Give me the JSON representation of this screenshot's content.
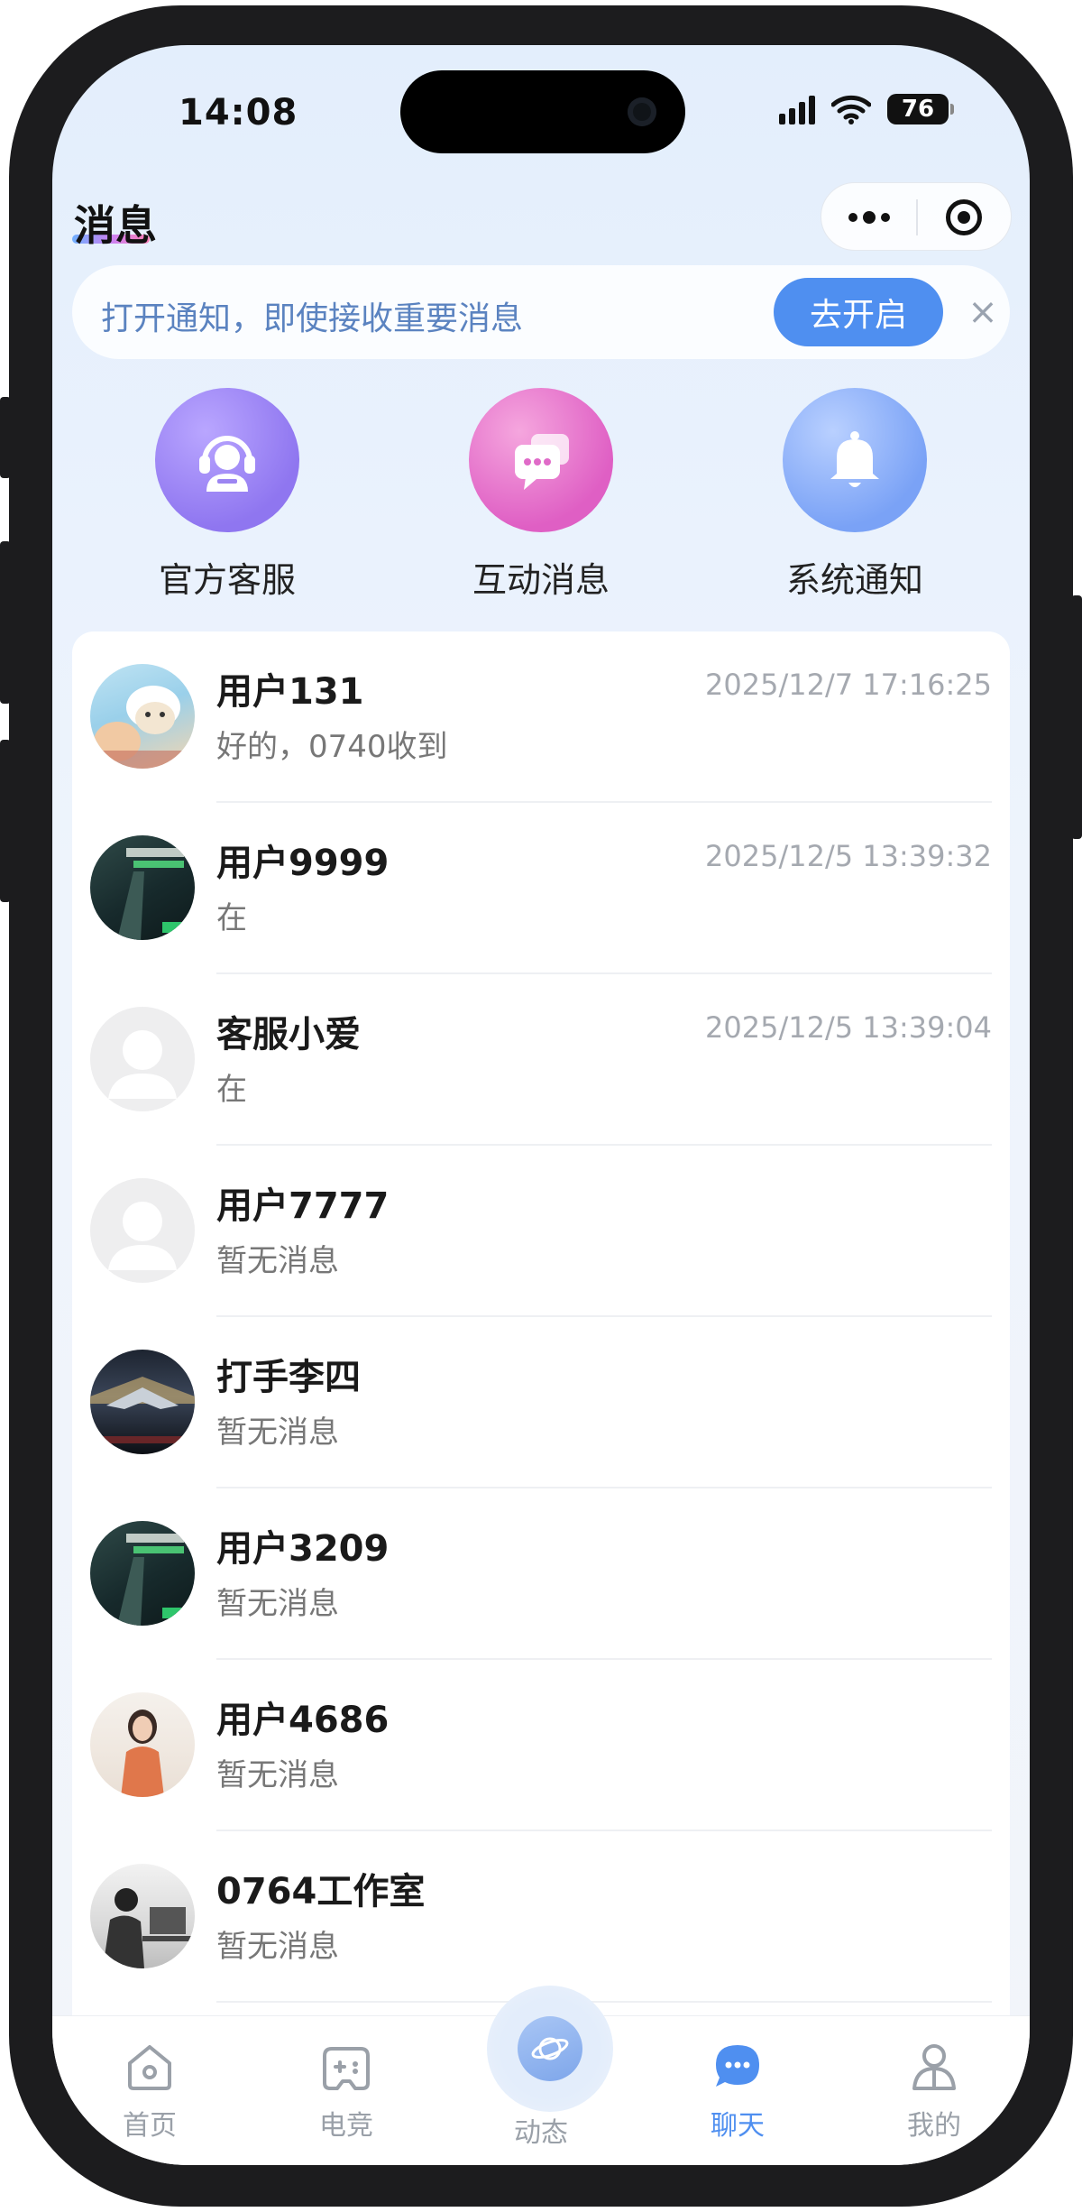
{
  "status_bar": {
    "time": "14:08",
    "battery": "76"
  },
  "header": {
    "title": "消息"
  },
  "notify_bar": {
    "text": "打开通知，即使接收重要消息",
    "button": "去开启",
    "close": "×"
  },
  "quick_entries": [
    {
      "label": "官方客服",
      "icon": "headset-agent-icon"
    },
    {
      "label": "互动消息",
      "icon": "chat-bubbles-icon"
    },
    {
      "label": "系统通知",
      "icon": "bell-icon"
    }
  ],
  "conversations": [
    {
      "name": "用户131",
      "time": "2025/12/7 17:16:25",
      "preview": "好的，0740收到",
      "avatar": "cartoon-sheep"
    },
    {
      "name": "用户9999",
      "time": "2025/12/5 13:39:32",
      "preview": "在",
      "avatar": "game-poster"
    },
    {
      "name": "客服小爱",
      "time": "2025/12/5 13:39:04",
      "preview": "在",
      "avatar": "default"
    },
    {
      "name": "用户7777",
      "time": "",
      "preview": "暂无消息",
      "avatar": "default"
    },
    {
      "name": "打手李四",
      "time": "",
      "preview": "暂无消息",
      "avatar": "jet"
    },
    {
      "name": "用户3209",
      "time": "",
      "preview": "暂无消息",
      "avatar": "game-poster"
    },
    {
      "name": "用户4686",
      "time": "",
      "preview": "暂无消息",
      "avatar": "girl-photo"
    },
    {
      "name": "0764工作室",
      "time": "",
      "preview": "暂无消息",
      "avatar": "office-photo"
    }
  ],
  "tabs": [
    {
      "label": "首页",
      "icon": "home-icon"
    },
    {
      "label": "电竞",
      "icon": "gamepad-icon"
    },
    {
      "label": "动态",
      "icon": "planet-icon"
    },
    {
      "label": "聊天",
      "icon": "chat-icon",
      "active": true
    },
    {
      "label": "我的",
      "icon": "person-icon"
    }
  ],
  "colors": {
    "accent": "#4f8ff0",
    "notify_text": "#5b83c0"
  }
}
